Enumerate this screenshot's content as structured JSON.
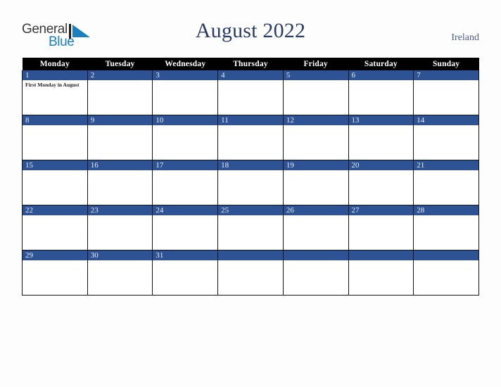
{
  "logo": {
    "word_one": "General",
    "word_two": "Blue",
    "mark": "blue-triangle"
  },
  "header": {
    "title": "August 2022",
    "country": "Ireland"
  },
  "calendar": {
    "weekday_headers": [
      "Monday",
      "Tuesday",
      "Wednesday",
      "Thursday",
      "Friday",
      "Saturday",
      "Sunday"
    ],
    "weeks": [
      [
        {
          "day": "1",
          "event": "First Monday in August"
        },
        {
          "day": "2",
          "event": ""
        },
        {
          "day": "3",
          "event": ""
        },
        {
          "day": "4",
          "event": ""
        },
        {
          "day": "5",
          "event": ""
        },
        {
          "day": "6",
          "event": ""
        },
        {
          "day": "7",
          "event": ""
        }
      ],
      [
        {
          "day": "8",
          "event": ""
        },
        {
          "day": "9",
          "event": ""
        },
        {
          "day": "10",
          "event": ""
        },
        {
          "day": "11",
          "event": ""
        },
        {
          "day": "12",
          "event": ""
        },
        {
          "day": "13",
          "event": ""
        },
        {
          "day": "14",
          "event": ""
        }
      ],
      [
        {
          "day": "15",
          "event": ""
        },
        {
          "day": "16",
          "event": ""
        },
        {
          "day": "17",
          "event": ""
        },
        {
          "day": "18",
          "event": ""
        },
        {
          "day": "19",
          "event": ""
        },
        {
          "day": "20",
          "event": ""
        },
        {
          "day": "21",
          "event": ""
        }
      ],
      [
        {
          "day": "22",
          "event": ""
        },
        {
          "day": "23",
          "event": ""
        },
        {
          "day": "24",
          "event": ""
        },
        {
          "day": "25",
          "event": ""
        },
        {
          "day": "26",
          "event": ""
        },
        {
          "day": "27",
          "event": ""
        },
        {
          "day": "28",
          "event": ""
        }
      ],
      [
        {
          "day": "29",
          "event": ""
        },
        {
          "day": "30",
          "event": ""
        },
        {
          "day": "31",
          "event": ""
        },
        {
          "day": "",
          "event": ""
        },
        {
          "day": "",
          "event": ""
        },
        {
          "day": "",
          "event": ""
        },
        {
          "day": "",
          "event": ""
        }
      ]
    ]
  },
  "colors": {
    "day_band": "#2e5395",
    "header_band": "#000000",
    "title_text": "#2b3c68",
    "country_text": "#4a5c86",
    "logo_blue": "#1a7fc1",
    "page_background": "#fdfdfd"
  }
}
